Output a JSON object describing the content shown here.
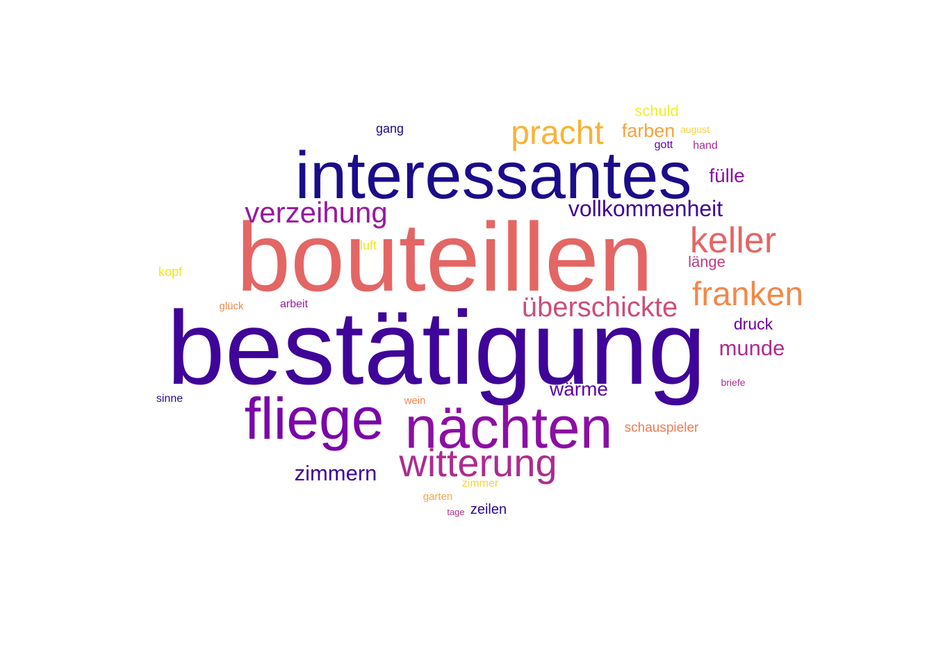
{
  "colors": {
    "navy": "#1b0c8a",
    "indigo": "#3f0599",
    "violet": "#5e03a5",
    "purple": "#8b0fa4",
    "magenta": "#ac2c90",
    "rose": "#cb4e7a",
    "coral": "#e36664",
    "orange": "#f3884a",
    "amber": "#f8b336",
    "yellow": "#eef02a"
  },
  "words": [
    {
      "id": "bestaetigung",
      "text": "bestätigung",
      "color": "#3f0599"
    },
    {
      "id": "bouteillen",
      "text": "bouteillen",
      "color": "#e36664"
    },
    {
      "id": "interessantes",
      "text": "interessantes",
      "color": "#1b0c8a"
    },
    {
      "id": "naechten",
      "text": "nächten",
      "color": "#8b0fa4"
    },
    {
      "id": "fliege",
      "text": "fliege",
      "color": "#7a06a8"
    },
    {
      "id": "witterung",
      "text": "witterung",
      "color": "#ac2c90"
    },
    {
      "id": "pracht",
      "text": "pracht",
      "color": "#f8b336"
    },
    {
      "id": "keller",
      "text": "keller",
      "color": "#e36664"
    },
    {
      "id": "franken",
      "text": "franken",
      "color": "#f3884a"
    },
    {
      "id": "verzeihung",
      "text": "verzeihung",
      "color": "#98189f"
    },
    {
      "id": "ueberschickte",
      "text": "überschickte",
      "color": "#cb4e7a"
    },
    {
      "id": "vollkommenheit",
      "text": "vollkommenheit",
      "color": "#3f0599"
    },
    {
      "id": "zimmern",
      "text": "zimmern",
      "color": "#3f0599"
    },
    {
      "id": "munde",
      "text": "munde",
      "color": "#ac2c90"
    },
    {
      "id": "waerme",
      "text": "wärme",
      "color": "#5e03a5"
    },
    {
      "id": "fuelle",
      "text": "fülle",
      "color": "#8b0fa4"
    },
    {
      "id": "farben",
      "text": "farben",
      "color": "#f8a23c"
    },
    {
      "id": "druck",
      "text": "druck",
      "color": "#6a00a8"
    },
    {
      "id": "schuld",
      "text": "schuld",
      "color": "#eef02a"
    },
    {
      "id": "laenge",
      "text": "länge",
      "color": "#c23b80"
    },
    {
      "id": "schauspieler",
      "text": "schauspieler",
      "color": "#ef7b52"
    },
    {
      "id": "zeilen",
      "text": "zeilen",
      "color": "#2a0790"
    },
    {
      "id": "gang",
      "text": "gang",
      "color": "#1b0c8a"
    },
    {
      "id": "luft",
      "text": "luft",
      "color": "#f5e41c"
    },
    {
      "id": "kopf",
      "text": "kopf",
      "color": "#f5e41c"
    },
    {
      "id": "gott",
      "text": "gott",
      "color": "#6a00a8"
    },
    {
      "id": "hand",
      "text": "hand",
      "color": "#ac2c90"
    },
    {
      "id": "sinne",
      "text": "sinne",
      "color": "#2a0790"
    },
    {
      "id": "arbeit",
      "text": "arbeit",
      "color": "#98189f"
    },
    {
      "id": "zimmer",
      "text": "zimmer",
      "color": "#f7d23b"
    },
    {
      "id": "garten",
      "text": "garten",
      "color": "#f8a23c"
    },
    {
      "id": "wein",
      "text": "wein",
      "color": "#f3884a"
    },
    {
      "id": "glueck",
      "text": "glück",
      "color": "#f3884a"
    },
    {
      "id": "august",
      "text": "august",
      "color": "#f7d23b"
    },
    {
      "id": "briefe",
      "text": "briefe",
      "color": "#ac2c90"
    },
    {
      "id": "tage",
      "text": "tage",
      "color": "#ac2c90"
    }
  ]
}
